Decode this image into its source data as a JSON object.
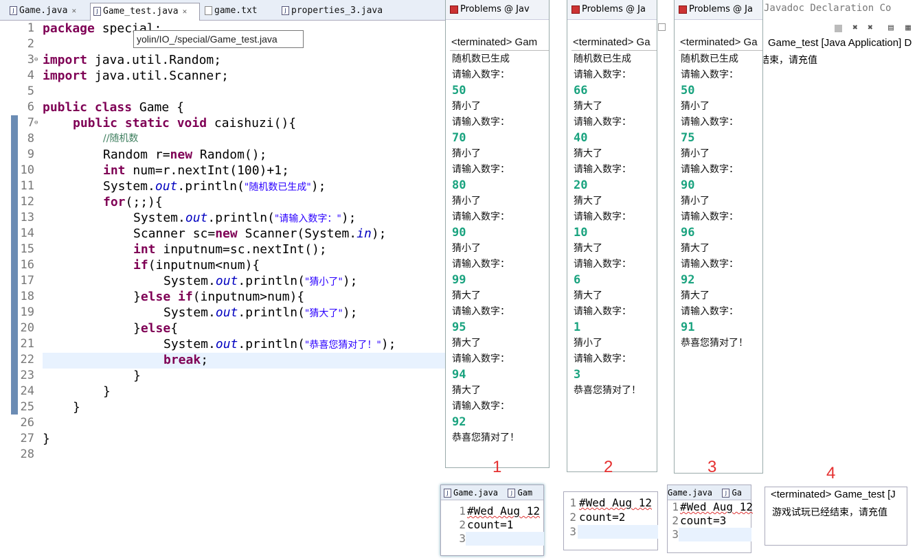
{
  "editor": {
    "tabs": [
      {
        "label": "Game.java",
        "closable": true
      },
      {
        "label": "Game_test.java",
        "closable": true
      },
      {
        "label": "game.txt",
        "closable": false
      },
      {
        "label": "properties_3.java",
        "closable": false
      }
    ],
    "tooltip": "yolin/IO_/special/Game_test.java",
    "line_numbers": [
      "1",
      "2",
      "3",
      "4",
      "5",
      "6",
      "7",
      "8",
      "9",
      "10",
      "11",
      "12",
      "13",
      "14",
      "15",
      "16",
      "17",
      "18",
      "19",
      "20",
      "21",
      "22",
      "23",
      "24",
      "25",
      "26",
      "27",
      "28"
    ],
    "code": {
      "l1_kw": "package",
      "l1_rest": " special;",
      "l3_kw": "import",
      "l3_rest": " java.util.Random;",
      "l4_kw": "import",
      "l4_rest": " java.util.Scanner;",
      "l6_kw": "public class",
      "l6_rest": " Game {",
      "l7_kw": "public static void",
      "l7_rest": " caishuzi(){",
      "l8_comment": "//随机数",
      "l9_a": "Random r=",
      "l9_kw": "new",
      "l9_b": " Random();",
      "l10_kw": "int",
      "l10_rest": " num=r.nextInt(100)+1;",
      "l11_a": "System.",
      "l11_f": "out",
      "l11_b": ".println(",
      "l11_s": "\"随机数已生成\"",
      "l11_c": ");",
      "l12_kw": "for",
      "l12_rest": "(;;){",
      "l13_a": "System.",
      "l13_f": "out",
      "l13_b": ".println(",
      "l13_s": "\"请输入数字：\"",
      "l13_c": ");",
      "l14_a": "Scanner sc=",
      "l14_kw": "new",
      "l14_b": " Scanner(System.",
      "l14_f": "in",
      "l14_c": ");",
      "l15_kw": "int",
      "l15_rest": " inputnum=sc.nextInt();",
      "l16_kw": "if",
      "l16_rest": "(inputnum<num){",
      "l17_a": "System.",
      "l17_f": "out",
      "l17_b": ".println(",
      "l17_s": "\"猜小了\"",
      "l17_c": ");",
      "l18_a": "}",
      "l18_kw": "else if",
      "l18_rest": "(inputnum>num){",
      "l19_a": "System.",
      "l19_f": "out",
      "l19_b": ".println(",
      "l19_s": "\"猜大了\"",
      "l19_c": ");",
      "l20_a": "}",
      "l20_kw": "else",
      "l20_rest": "{",
      "l21_a": "System.",
      "l21_f": "out",
      "l21_b": ".println(",
      "l21_s": "\"恭喜您猜对了！\"",
      "l21_c": ");",
      "l22_kw": "break",
      "l22_rest": ";",
      "l23": "}",
      "l24": "}",
      "l25": "}",
      "l27": "}"
    }
  },
  "consoles": [
    {
      "number": "1",
      "header": "Problems  @ Jav",
      "status": "<terminated> Gam",
      "lines": [
        {
          "t": "随机数已生成",
          "in": false
        },
        {
          "t": "请输入数字：",
          "in": false
        },
        {
          "t": "50",
          "in": true
        },
        {
          "t": "猜小了",
          "in": false
        },
        {
          "t": "请输入数字：",
          "in": false
        },
        {
          "t": "70",
          "in": true
        },
        {
          "t": "猜小了",
          "in": false
        },
        {
          "t": "请输入数字：",
          "in": false
        },
        {
          "t": "80",
          "in": true
        },
        {
          "t": "猜小了",
          "in": false
        },
        {
          "t": "请输入数字：",
          "in": false
        },
        {
          "t": "90",
          "in": true
        },
        {
          "t": "猜小了",
          "in": false
        },
        {
          "t": "请输入数字：",
          "in": false
        },
        {
          "t": "99",
          "in": true
        },
        {
          "t": "猜大了",
          "in": false
        },
        {
          "t": "请输入数字：",
          "in": false
        },
        {
          "t": "95",
          "in": true
        },
        {
          "t": "猜大了",
          "in": false
        },
        {
          "t": "请输入数字：",
          "in": false
        },
        {
          "t": "94",
          "in": true
        },
        {
          "t": "猜大了",
          "in": false
        },
        {
          "t": "请输入数字：",
          "in": false
        },
        {
          "t": "92",
          "in": true
        },
        {
          "t": "恭喜您猜对了！",
          "in": false
        }
      ]
    },
    {
      "number": "2",
      "header": "Problems  @ Ja",
      "status": "<terminated> Ga",
      "lines": [
        {
          "t": "随机数已生成",
          "in": false
        },
        {
          "t": "请输入数字：",
          "in": false
        },
        {
          "t": "66",
          "in": true
        },
        {
          "t": "猜大了",
          "in": false
        },
        {
          "t": "请输入数字：",
          "in": false
        },
        {
          "t": "40",
          "in": true
        },
        {
          "t": "猜大了",
          "in": false
        },
        {
          "t": "请输入数字：",
          "in": false
        },
        {
          "t": "20",
          "in": true
        },
        {
          "t": "猜大了",
          "in": false
        },
        {
          "t": "请输入数字：",
          "in": false
        },
        {
          "t": "10",
          "in": true
        },
        {
          "t": "猜大了",
          "in": false
        },
        {
          "t": "请输入数字：",
          "in": false
        },
        {
          "t": "6",
          "in": true
        },
        {
          "t": "猜大了",
          "in": false
        },
        {
          "t": "请输入数字：",
          "in": false
        },
        {
          "t": "1",
          "in": true
        },
        {
          "t": "猜小了",
          "in": false
        },
        {
          "t": "请输入数字：",
          "in": false
        },
        {
          "t": "3",
          "in": true
        },
        {
          "t": "恭喜您猜对了！",
          "in": false
        }
      ]
    },
    {
      "number": "3",
      "header": "Problems  @ Ja",
      "status": "<terminated> Ga",
      "lines": [
        {
          "t": "随机数已生成",
          "in": false
        },
        {
          "t": "请输入数字：",
          "in": false
        },
        {
          "t": "50",
          "in": true
        },
        {
          "t": "猜小了",
          "in": false
        },
        {
          "t": "请输入数字：",
          "in": false
        },
        {
          "t": "75",
          "in": true
        },
        {
          "t": "猜小了",
          "in": false
        },
        {
          "t": "请输入数字：",
          "in": false
        },
        {
          "t": "90",
          "in": true
        },
        {
          "t": "猜小了",
          "in": false
        },
        {
          "t": "请输入数字：",
          "in": false
        },
        {
          "t": "96",
          "in": true
        },
        {
          "t": "猜大了",
          "in": false
        },
        {
          "t": "请输入数字：",
          "in": false
        },
        {
          "t": "92",
          "in": true
        },
        {
          "t": "猜大了",
          "in": false
        },
        {
          "t": "请输入数字：",
          "in": false
        },
        {
          "t": "91",
          "in": true
        },
        {
          "t": "恭喜您猜对了！",
          "in": false
        }
      ]
    }
  ],
  "background_console": {
    "tabs": "Javadoc  Declaration  Co",
    "status": "Game_test [Java Application] D",
    "text": "结束，请充值"
  },
  "mini_editors": [
    {
      "tab1": "Game.java",
      "tab2": "Gam",
      "lines": [
        "1",
        "2",
        "3"
      ],
      "line1": "#Wed Aug 12",
      "line2": "count=1"
    },
    {
      "tab1": "",
      "tab2": "",
      "lines": [
        "1",
        "2",
        "3"
      ],
      "line1": "#Wed Aug 12",
      "line2": "count=2"
    },
    {
      "tab1": "Game.java",
      "tab2": "Ga",
      "lines": [
        "1",
        "2",
        "3"
      ],
      "line1": "#Wed Aug 12",
      "line2": "count=3"
    }
  ],
  "final_console": {
    "number": "4",
    "status": "<terminated> Game_test [J",
    "message": "游戏试玩已经结束，请充值"
  },
  "colors": {
    "keyword": "#7f0055",
    "string": "#2a00ff",
    "comment": "#3f7f5f",
    "field": "#0000c0",
    "user_input": "#1aa37f",
    "annotation_number": "#e53030"
  }
}
